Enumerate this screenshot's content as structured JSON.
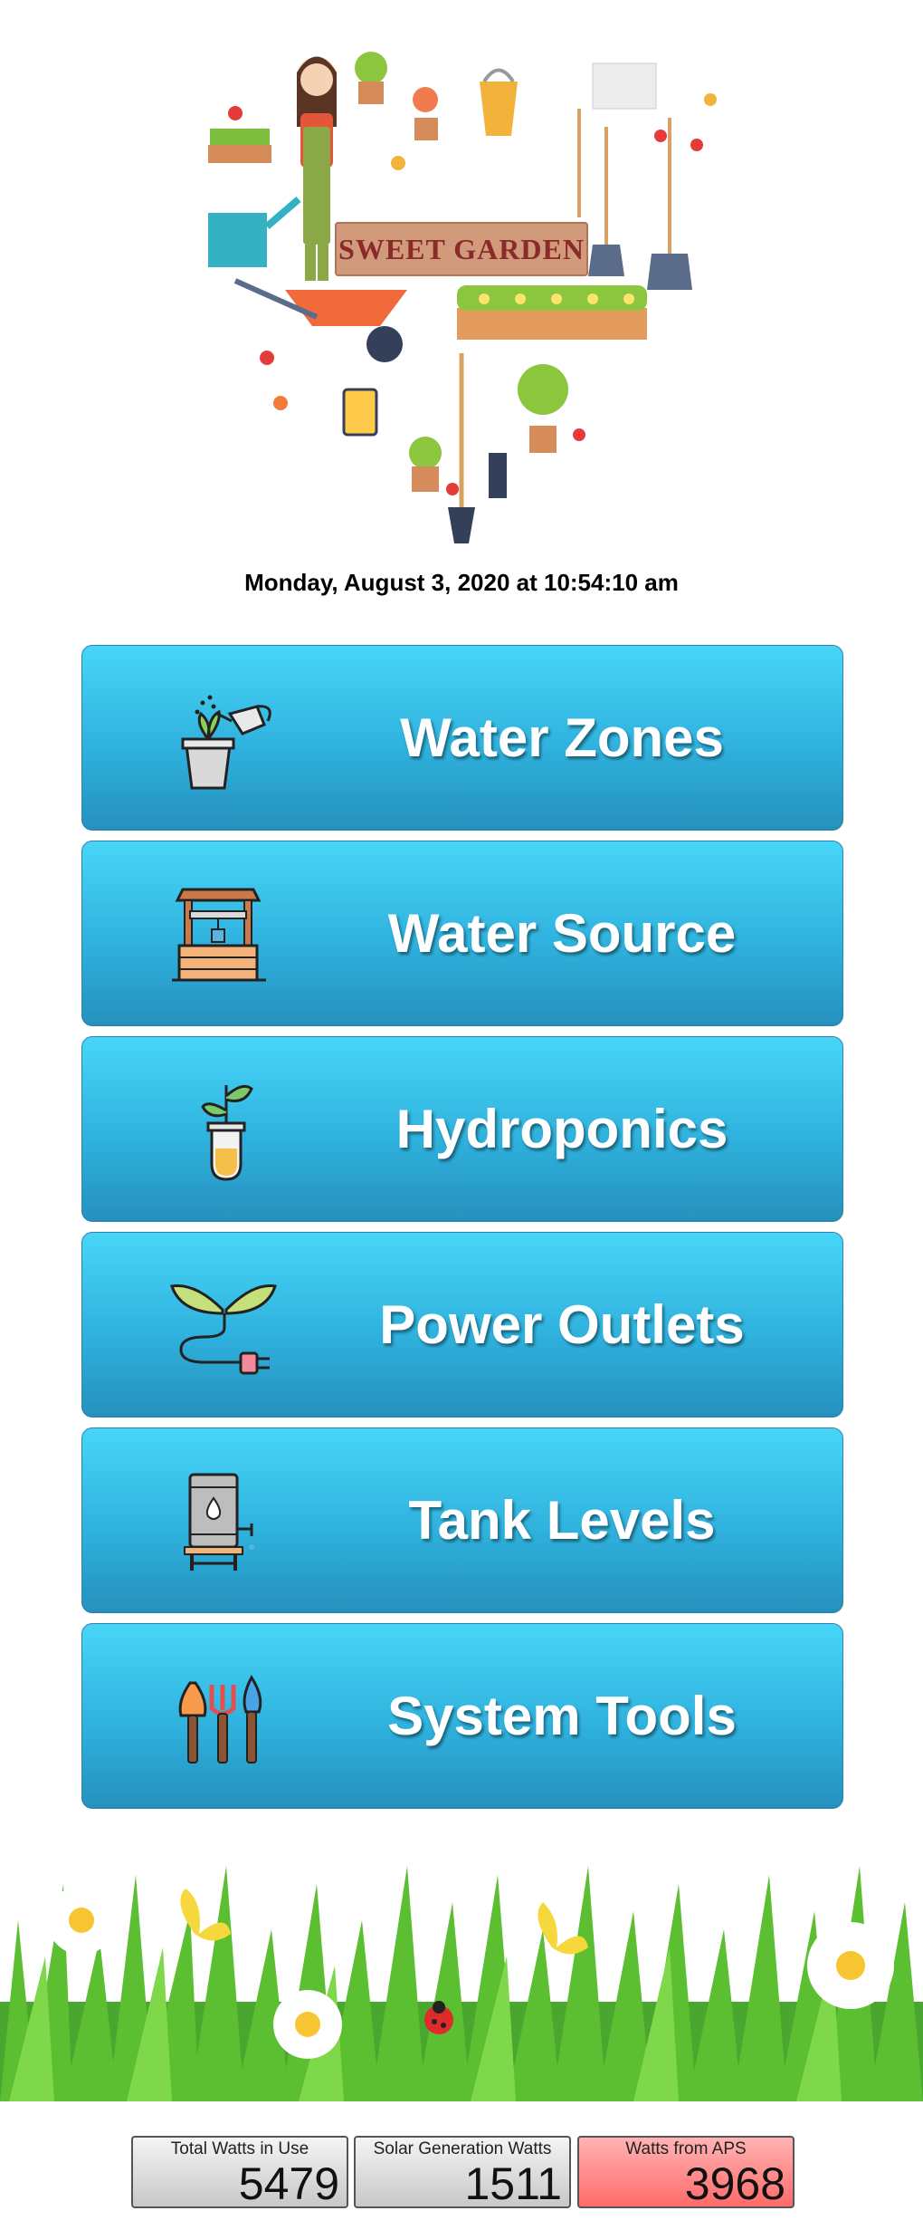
{
  "header": {
    "banner_title": "SWEET GARDEN",
    "datetime": "Monday, August 3, 2020 at 10:54:10 am"
  },
  "menu": [
    {
      "label": "Water Zones",
      "icon": "watering-can-plant-icon"
    },
    {
      "label": "Water Source",
      "icon": "water-well-icon"
    },
    {
      "label": "Hydroponics",
      "icon": "test-tube-plant-icon"
    },
    {
      "label": "Power Outlets",
      "icon": "leaf-plug-icon"
    },
    {
      "label": "Tank Levels",
      "icon": "water-tank-icon"
    },
    {
      "label": "System Tools",
      "icon": "garden-tools-icon"
    }
  ],
  "meters": [
    {
      "title": "Total Watts in Use",
      "value": "5479"
    },
    {
      "title": "Solar Generation Watts",
      "value": "1511"
    },
    {
      "title": "Watts from APS",
      "value": "3968"
    }
  ],
  "colors": {
    "button_top": "#48d6f8",
    "button_bottom": "#2590bd",
    "aps_meter": "#ff6a6a"
  }
}
